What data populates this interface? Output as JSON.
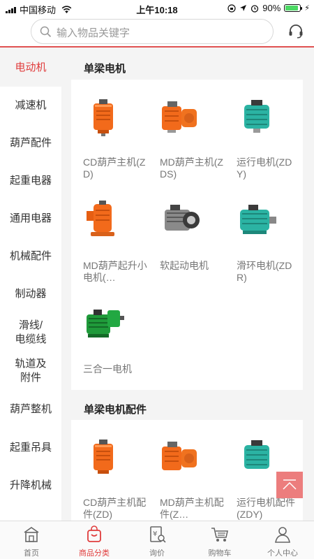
{
  "status_bar": {
    "carrier": "中国移动",
    "time": "上午10:18",
    "battery": "90%"
  },
  "search": {
    "placeholder": "输入物品关键字"
  },
  "sidebar": {
    "items": [
      {
        "label": "电动机",
        "active": true
      },
      {
        "label": "减速机"
      },
      {
        "label": "葫芦配件"
      },
      {
        "label": "起重电器"
      },
      {
        "label": "通用电器"
      },
      {
        "label": "机械配件"
      },
      {
        "label": "制动器"
      },
      {
        "label": "滑线/\n电缆线"
      },
      {
        "label": "轨道及\n附件"
      },
      {
        "label": "葫芦整机"
      },
      {
        "label": "起重吊具"
      },
      {
        "label": "升降机械"
      }
    ]
  },
  "sections": [
    {
      "title": "单梁电机",
      "products": [
        {
          "name": "CD葫芦主机(ZD)",
          "icon": "orange-motor"
        },
        {
          "name": "MD葫芦主机(ZDS)",
          "icon": "orange-motor-dual"
        },
        {
          "name": "运行电机(ZDY)",
          "icon": "teal-motor"
        },
        {
          "name": "MD葫芦起升小电机(…",
          "icon": "orange-motor-flange"
        },
        {
          "name": "软起动电机",
          "icon": "gray-motor"
        },
        {
          "name": "滑环电机(ZDR)",
          "icon": "teal-motor-long"
        },
        {
          "name": "三合一电机",
          "icon": "green-motor"
        }
      ]
    },
    {
      "title": "单梁电机配件",
      "products": [
        {
          "name": "CD葫芦主机配件(ZD)",
          "icon": "orange-motor"
        },
        {
          "name": "MD葫芦主机配件(Z…",
          "icon": "orange-motor-dual"
        },
        {
          "name": "运行电机配件(ZDY)",
          "icon": "teal-motor"
        }
      ]
    }
  ],
  "tabbar": {
    "items": [
      {
        "label": "首页",
        "icon": "home-icon"
      },
      {
        "label": "商品分类",
        "icon": "bag-icon",
        "active": true
      },
      {
        "label": "询价",
        "icon": "inquiry-icon"
      },
      {
        "label": "购物车",
        "icon": "cart-icon"
      },
      {
        "label": "个人中心",
        "icon": "user-icon"
      }
    ]
  },
  "colors": {
    "accent": "#e03c3c",
    "back_top": "#ec7d7d",
    "orange_motor": "#f26a1b",
    "teal_motor": "#2bb3a3",
    "green_motor": "#1f9a3a"
  }
}
